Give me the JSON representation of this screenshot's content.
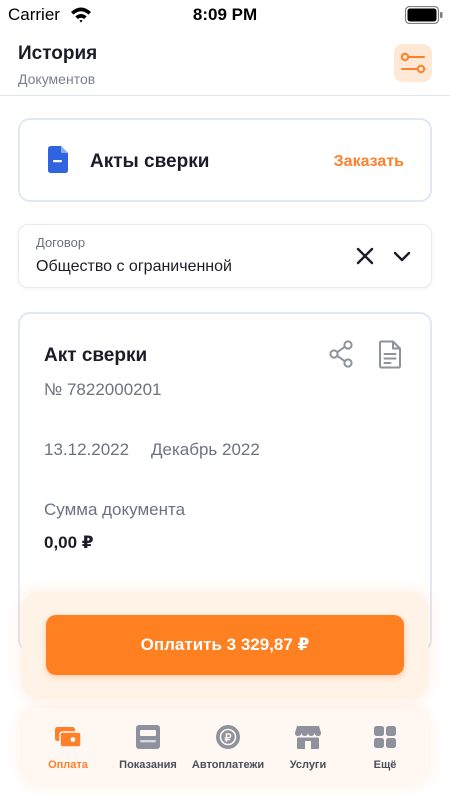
{
  "status_bar": {
    "carrier": "Carrier",
    "time": "8:09 PM"
  },
  "header": {
    "title": "История",
    "subtitle": "Документов"
  },
  "acts_card": {
    "title": "Акты сверки",
    "order_label": "Заказать"
  },
  "contract": {
    "label": "Договор",
    "value": "Общество с ограниченной"
  },
  "act": {
    "title": "Акт сверки",
    "number": "№ 7822000201",
    "date": "13.12.2022",
    "period": "Декабрь 2022",
    "sum_label": "Сумма документа",
    "sum_value": "0,00 ₽"
  },
  "pay_button": {
    "label": "Оплатить 3 329,87 ₽"
  },
  "tab_bar": {
    "active": "Оплата",
    "tabs": [
      {
        "label": "Оплата",
        "icon": "wallet-icon"
      },
      {
        "label": "Показания",
        "icon": "meter-icon"
      },
      {
        "label": "Автоплатежи",
        "icon": "autopay-icon"
      },
      {
        "label": "Услуги",
        "icon": "shop-icon"
      },
      {
        "label": "Ещё",
        "icon": "more-grid-icon"
      }
    ]
  },
  "colors": {
    "accent": "#ff7f2a",
    "pay_button": "#ff8021",
    "text_primary": "#1c1c28",
    "text_secondary": "#6d7280",
    "doc_icon": "#2f63e0",
    "inactive_icon": "#8d929c"
  }
}
